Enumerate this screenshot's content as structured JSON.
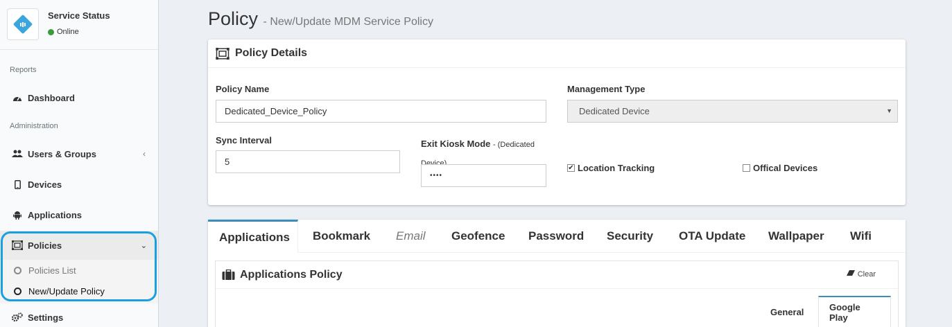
{
  "brand": {
    "title": "Service Status",
    "status": "Online"
  },
  "sidebar": {
    "sections": {
      "reports": "Reports",
      "administration": "Administration"
    },
    "items": {
      "dashboard": "Dashboard",
      "users_groups": "Users & Groups",
      "devices": "Devices",
      "applications": "Applications",
      "policies": "Policies",
      "policies_list": "Policies List",
      "new_update_policy": "New/Update Policy",
      "settings": "Settings"
    }
  },
  "page": {
    "title": "Policy",
    "subtitle": "- New/Update MDM Service Policy"
  },
  "policy_details": {
    "header": "Policy Details",
    "policy_name_label": "Policy Name",
    "policy_name_value": "Dedicated_Device_Policy",
    "management_type_label": "Management Type",
    "management_type_value": "Dedicated Device",
    "sync_interval_label": "Sync Interval",
    "sync_interval_value": "5",
    "exit_kiosk_label": "Exit Kiosk Mode",
    "exit_kiosk_note_1": "- (Dedicated",
    "exit_kiosk_note_2": "Device)",
    "exit_kiosk_value": "••••",
    "location_tracking_label": "Location Tracking",
    "location_tracking_checked": true,
    "official_devices_label": "Offical Devices",
    "official_devices_checked": false
  },
  "tabs": [
    "Applications",
    "Bookmark",
    "Email",
    "Geofence",
    "Password",
    "Security",
    "OTA Update",
    "Wallpaper",
    "Wifi"
  ],
  "applications_policy": {
    "header": "Applications Policy",
    "clear_label": "Clear",
    "subtabs": {
      "general": "General",
      "google_play": "Google Play"
    }
  },
  "colors": {
    "accent": "#3c8dbc",
    "highlight": "#1a9fe0",
    "online": "#3c9a3c"
  }
}
